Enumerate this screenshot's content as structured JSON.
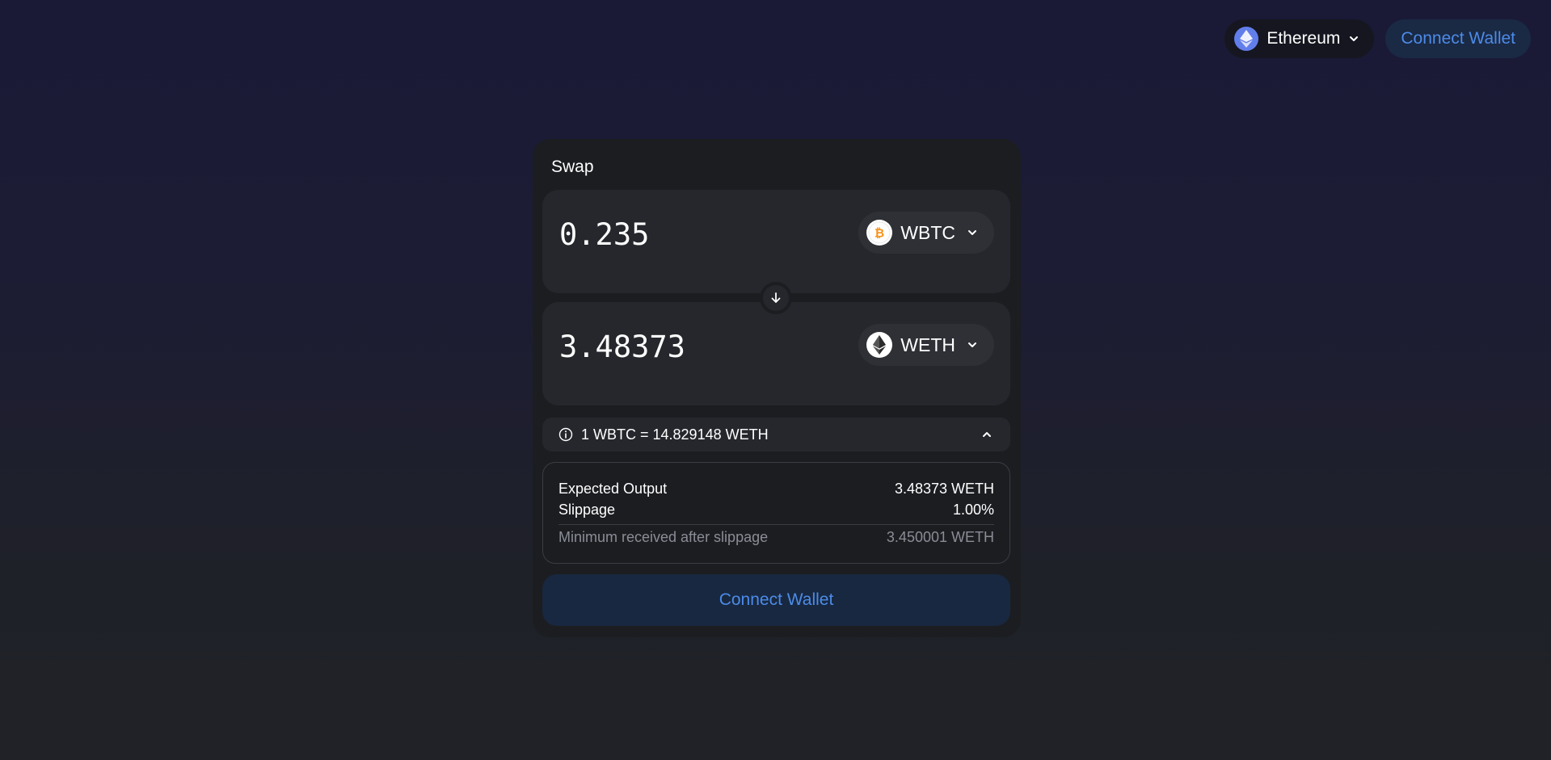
{
  "header": {
    "network": {
      "label": "Ethereum",
      "icon": "ethereum-icon"
    },
    "connect_wallet_label": "Connect Wallet"
  },
  "swap": {
    "title": "Swap",
    "from": {
      "amount": "0.235",
      "token": "WBTC",
      "icon": "bitcoin-icon"
    },
    "to": {
      "amount": "3.48373",
      "token": "WETH",
      "icon": "ethereum-icon"
    },
    "rate_text": "1 WBTC = 14.829148 WETH",
    "details": {
      "expected_output_label": "Expected Output",
      "expected_output_value": "3.48373 WETH",
      "slippage_label": "Slippage",
      "slippage_value": "1.00%",
      "min_received_label": "Minimum received after slippage",
      "min_received_value": "3.450001 WETH"
    },
    "connect_wallet_label": "Connect Wallet"
  },
  "colors": {
    "accent": "#4c8be8",
    "button_bg": "#182840",
    "eth_blue": "#627eea",
    "btc_orange": "#f7931a"
  }
}
